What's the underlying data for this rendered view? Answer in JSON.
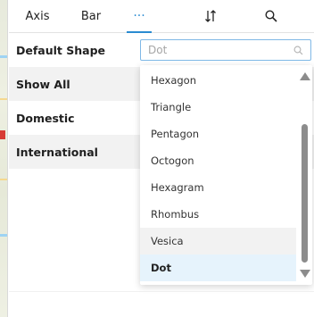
{
  "tabs": [
    {
      "label": "Axis"
    },
    {
      "label": "Bar"
    },
    {
      "label": "···"
    }
  ],
  "tab_icons": {
    "sort": "sort-swap-icon",
    "search": "search-icon"
  },
  "rows": {
    "default_shape": "Default Shape",
    "show_all": "Show All",
    "domestic": "Domestic",
    "international": "International"
  },
  "combo": {
    "placeholder": "Dot",
    "icon": "search-icon"
  },
  "dropdown": {
    "options": [
      "Hexagon",
      "Triangle",
      "Pentagon",
      "Octogon",
      "Hexagram",
      "Rhombus",
      "Vesica",
      "Dot"
    ],
    "hovered": "Vesica",
    "selected": "Dot"
  },
  "colors": {
    "accent": "#2a8bd1",
    "selected_bg": "#e6f3fc",
    "hover_bg": "#f2f2f2",
    "row_shade": "#f2f2f2"
  }
}
